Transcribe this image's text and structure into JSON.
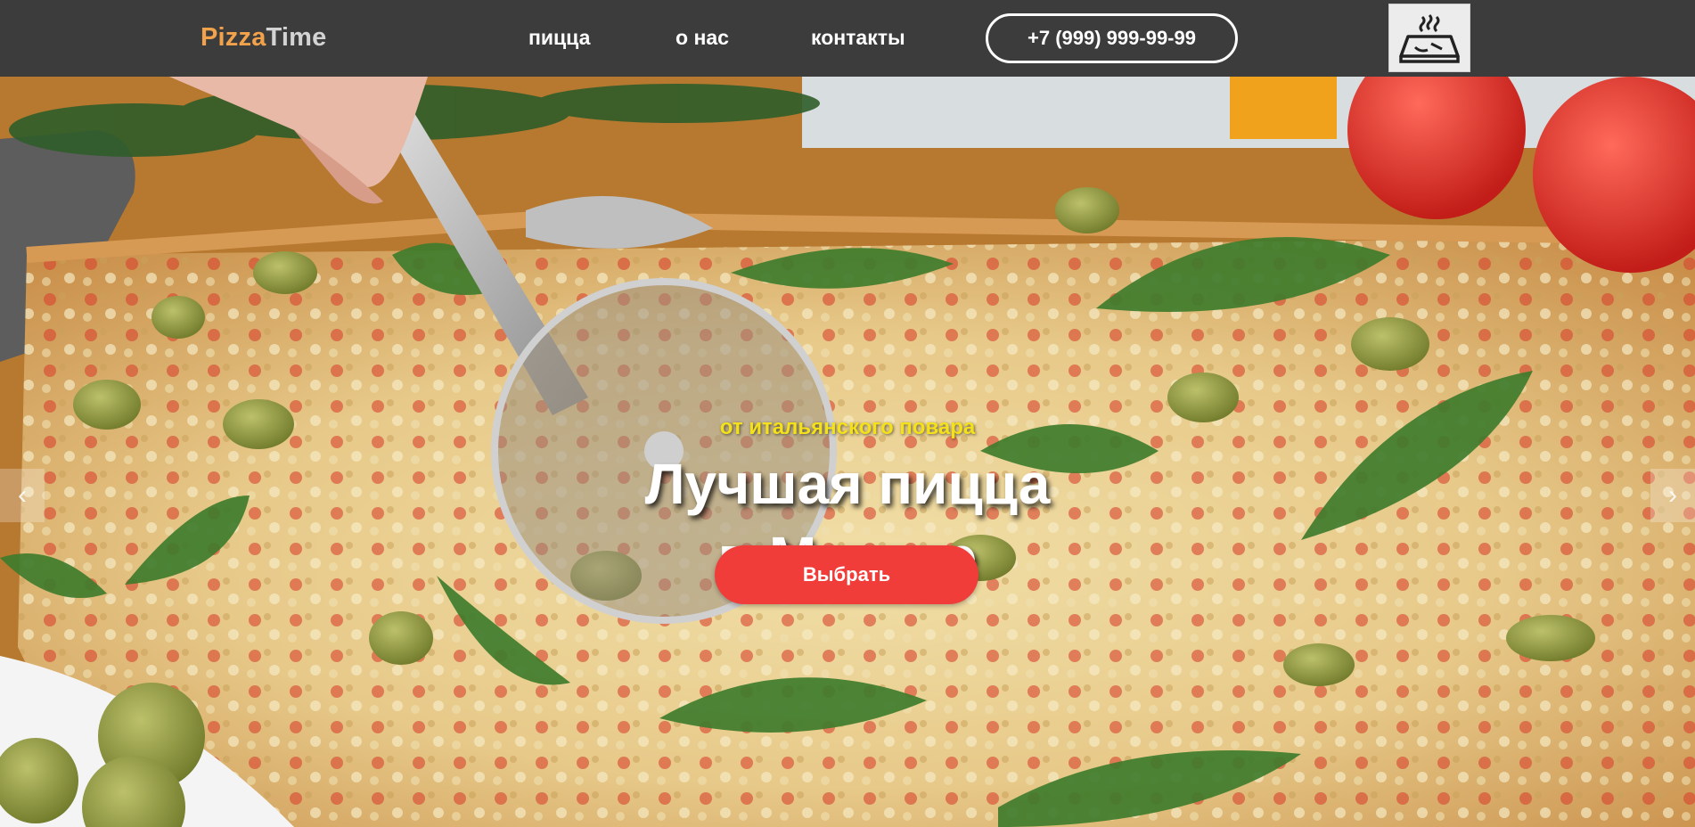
{
  "header": {
    "logo_part1": "Pizza",
    "logo_part2": "Time",
    "nav": [
      "пицца",
      "о нас",
      "контакты"
    ],
    "phone": "+7 (999) 999-99-99",
    "cart_icon": "delivery-box-icon"
  },
  "hero": {
    "subtitle": "от итальянского повара",
    "title_line1": "Лучшая пицца",
    "title_line2": "в Москве",
    "cta_label": "Выбрать",
    "prev_arrow": "‹",
    "next_arrow": "›"
  },
  "colors": {
    "header_bg": "#3c3c3c",
    "logo_accent": "#f2a24a",
    "logo_secondary": "#d3d3d3",
    "subtitle": "#f5e11a",
    "cta_bg": "#f13d3a"
  }
}
